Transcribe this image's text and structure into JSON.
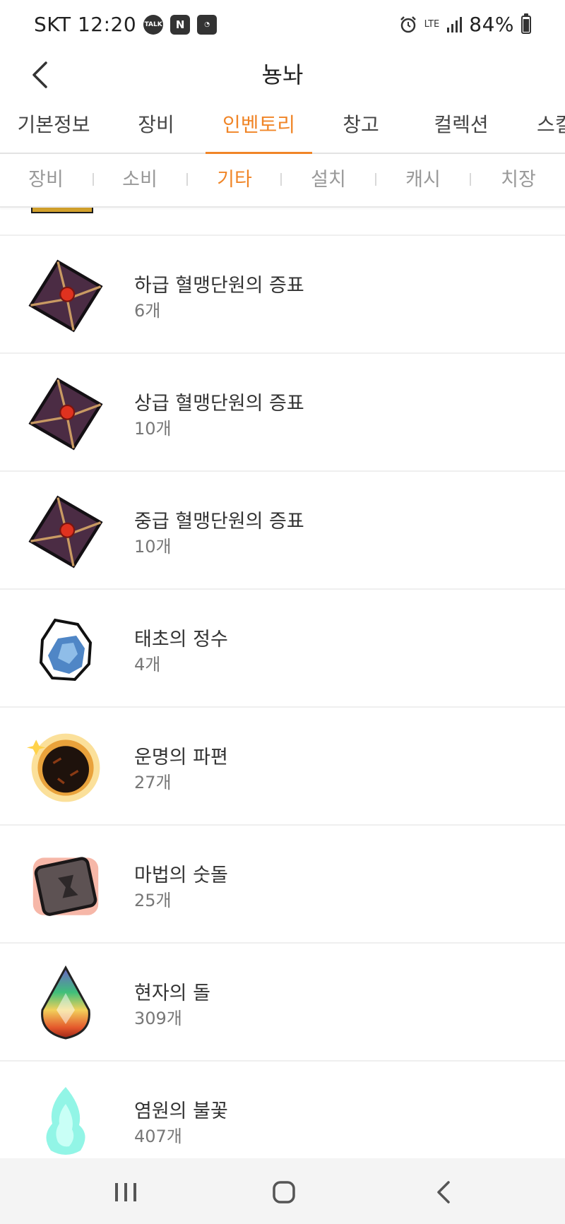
{
  "status_bar": {
    "carrier_time": "SKT 12:20",
    "notif_icons": [
      "TALK",
      "N",
      "◔"
    ],
    "network": "LTE",
    "battery": "84%"
  },
  "header": {
    "title": "뇽놔"
  },
  "main_tabs": [
    {
      "label": "기본정보",
      "active": false
    },
    {
      "label": "장비",
      "active": false
    },
    {
      "label": "인벤토리",
      "active": true
    },
    {
      "label": "창고",
      "active": false
    },
    {
      "label": "컬렉션",
      "active": false
    },
    {
      "label": "스킬",
      "active": false
    }
  ],
  "sub_tabs": [
    {
      "label": "장비",
      "active": false
    },
    {
      "label": "소비",
      "active": false
    },
    {
      "label": "기타",
      "active": true
    },
    {
      "label": "설치",
      "active": false
    },
    {
      "label": "캐시",
      "active": false
    },
    {
      "label": "치장",
      "active": false
    }
  ],
  "items": [
    {
      "name": "하급 혈맹단원의 증표",
      "count": "6개",
      "icon": "envelope-icon"
    },
    {
      "name": "상급 혈맹단원의 증표",
      "count": "10개",
      "icon": "envelope-icon"
    },
    {
      "name": "중급 혈맹단원의 증표",
      "count": "10개",
      "icon": "envelope-icon"
    },
    {
      "name": "태초의 정수",
      "count": "4개",
      "icon": "crystal-icon"
    },
    {
      "name": "운명의 파편",
      "count": "27개",
      "icon": "fragment-icon"
    },
    {
      "name": "마법의 숫돌",
      "count": "25개",
      "icon": "whetstone-icon"
    },
    {
      "name": "현자의 돌",
      "count": "309개",
      "icon": "gem-icon"
    },
    {
      "name": "염원의 불꽃",
      "count": "407개",
      "icon": "flame-icon"
    }
  ],
  "colors": {
    "accent": "#f08527",
    "text": "#333333",
    "muted": "#999999",
    "divider": "#efefef",
    "nav_bg": "#f4f4f4"
  }
}
